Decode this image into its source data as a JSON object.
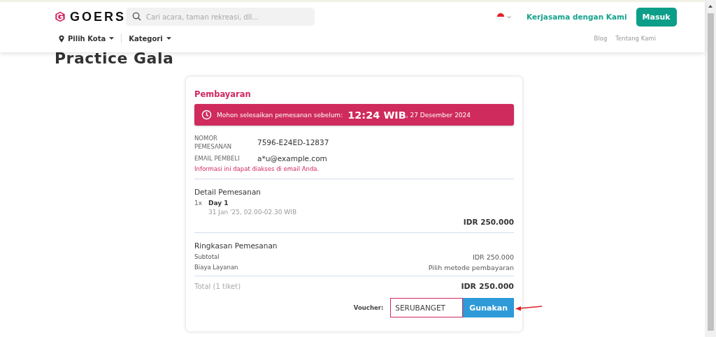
{
  "header": {
    "brand": "GOERS",
    "search": {
      "placeholder": "Cari acara, taman rekreasi, dll..."
    },
    "partner_link": "Kerjasama dengan Kami",
    "login_button": "Masuk",
    "nav_left": [
      {
        "label": "Pilih Kota",
        "kind": "location"
      },
      {
        "label": "Kategori",
        "kind": "plain"
      }
    ],
    "nav_right": [
      "Blog",
      "Tentang Kami"
    ]
  },
  "page_title": "Practice Gala",
  "payment": {
    "title": "Pembayaran",
    "deadline": {
      "message": "Mohon selesaikan pemesanan sebelum:",
      "time": "12:24 WIB",
      "date": ", 27 Desember 2024"
    },
    "info": [
      {
        "label": "NOMOR PEMESANAN",
        "value": "7596-E24ED-12837"
      },
      {
        "label": "EMAIL PEMBELI",
        "value": "a*u@example.com"
      }
    ],
    "info_note": "Informasi ini dapat diakses di email Anda.",
    "detail": {
      "title": "Detail Pemesanan",
      "items": [
        {
          "qty": "1x",
          "name": "Day 1",
          "schedule": "31 Jan '25, 02.00-02.30 WIB",
          "price": "IDR 250.000"
        }
      ]
    },
    "summary": {
      "title": "Ringkasan Pemesanan",
      "rows": [
        {
          "label": "Subtotal",
          "value": "IDR 250.000"
        },
        {
          "label": "Biaya Layanan",
          "value": "Pilih metode pembayaran"
        }
      ]
    },
    "total": {
      "label": "Total (1 tiket)",
      "value": "IDR 250.000"
    },
    "voucher": {
      "label": "Voucher:",
      "value": "SERUBANGET",
      "button": "Gunakan"
    }
  }
}
